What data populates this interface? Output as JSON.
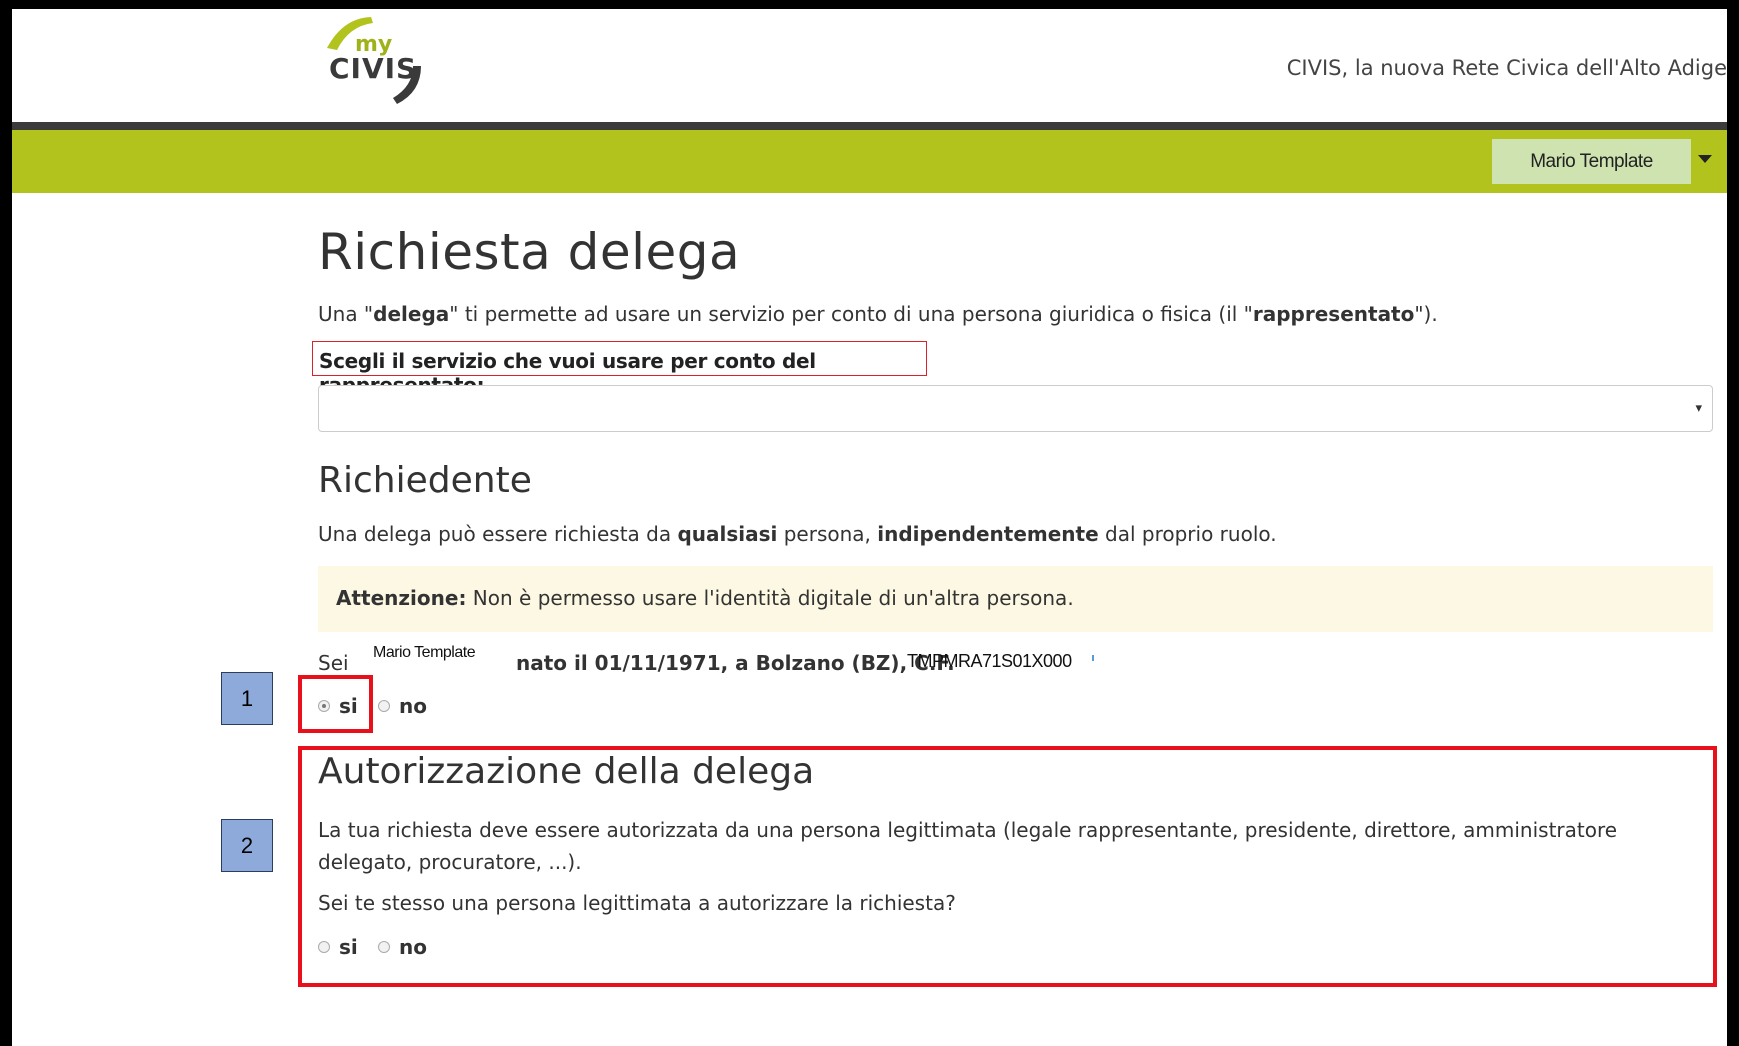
{
  "header": {
    "logo_top": "my",
    "logo_main": "CIVIS",
    "tagline": "CIVIS, la nuova Rete Civica dell'Alto Adige"
  },
  "user_menu": {
    "label": "Mario Template"
  },
  "page": {
    "title": "Richiesta delega",
    "intro": {
      "p1": "Una \"",
      "b1": "delega",
      "p2": "\" ti permette ad usare un servizio per conto di una persona giuridica o fisica (il \"",
      "b2": "rappresentato",
      "p3": "\")."
    },
    "service_label": "Scegli il servizio che vuoi usare per conto del rappresentato:",
    "service_select": {
      "value": "",
      "arrow": "▾"
    }
  },
  "richiedente": {
    "title": "Richiedente",
    "text": {
      "p1": "Una delega può essere richiesta da ",
      "b1": "qualsiasi",
      "p2": " persona, ",
      "b2": "indipendentemente",
      "p3": " dal proprio ruolo."
    },
    "alert": {
      "strong": "Attenzione:",
      "text": " Non è permesso usare l'identità digitale di un'altra persona."
    },
    "sei": "Sei",
    "name": "Mario Template",
    "birth": "nato il 01/11/1971, a Bolzano (BZ), C.F.",
    "cf": "TMPMRA71S01X000",
    "options": {
      "yes": "si",
      "no": "no"
    }
  },
  "autorizzazione": {
    "title": "Autorizzazione della delega",
    "text": "La tua richiesta deve essere autorizzata da una persona legittimata (legale rappresentante, presidente, direttore, amministratore delegato, procuratore, ...).",
    "question": "Sei te stesso una persona legittimata a autorizzare la richiesta?",
    "options": {
      "yes": "si",
      "no": "no"
    }
  },
  "callouts": {
    "first": "1",
    "second": "2"
  },
  "colors": {
    "green_bar": "#b2c31e",
    "highlight_red": "#e8101a",
    "callout_blue": "#8eaadb",
    "alert_bg": "#fcf8e3"
  }
}
